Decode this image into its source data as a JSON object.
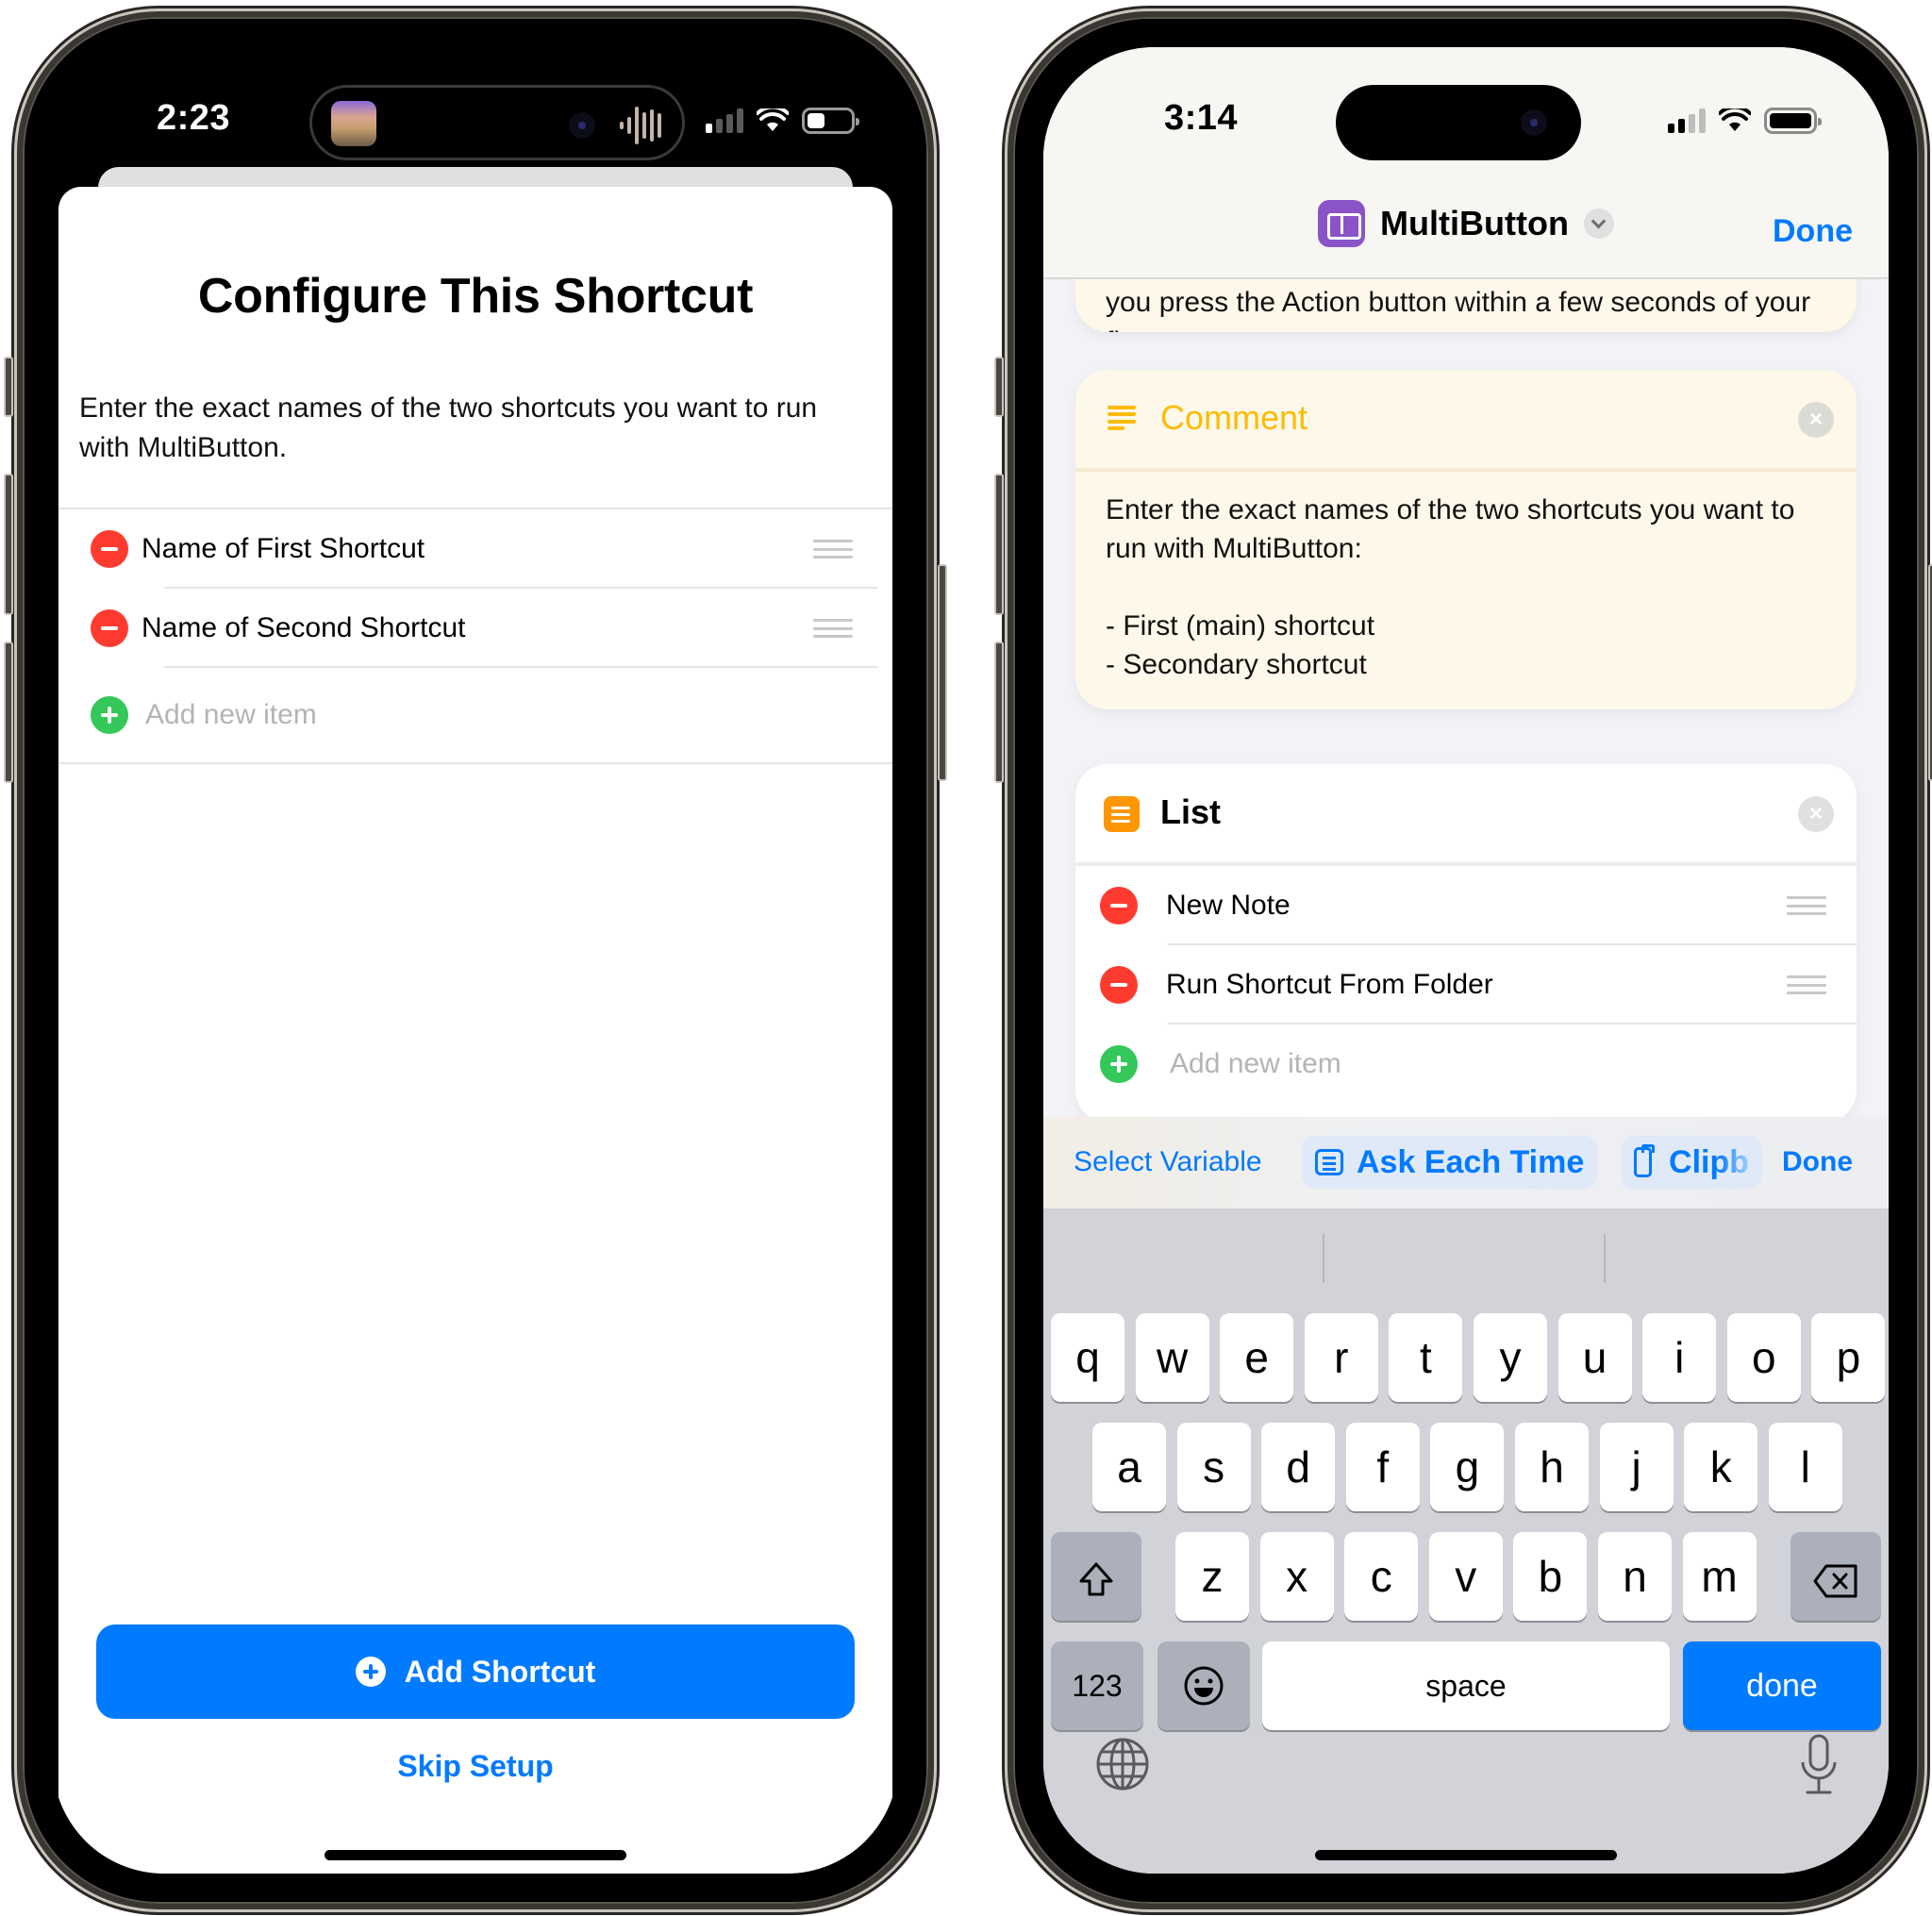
{
  "left_phone": {
    "status_bar": {
      "time": "2:23",
      "now_playing_icon": "album-art",
      "waveform_icon": "waveform",
      "signal_bars_active": 1,
      "battery_level": 0.4
    },
    "sheet": {
      "title": "Configure This Shortcut",
      "description": "Enter the exact names of the two shortcuts you want to run with MultiButton.",
      "items": [
        {
          "label": "Name of First Shortcut"
        },
        {
          "label": "Name of Second Shortcut"
        }
      ],
      "add_item_placeholder": "Add new item",
      "primary_button": "Add Shortcut",
      "secondary_link": "Skip Setup"
    }
  },
  "right_phone": {
    "status_bar": {
      "time": "3:14",
      "signal_bars_active": 2,
      "battery_level": 1.0
    },
    "nav_bar": {
      "title": "MultiButton",
      "done_label": "Done"
    },
    "clipped_card_text": "you press the Action button within a few seconds of your first",
    "comment_card": {
      "title": "Comment",
      "body": "Enter the exact names of the two shortcuts you want to run with MultiButton:\n\n- First (main) shortcut\n- Secondary shortcut"
    },
    "list_card": {
      "title": "List",
      "items": [
        {
          "label": "New Note"
        },
        {
          "label": "Run Shortcut From Folder"
        }
      ],
      "add_item_placeholder": "Add new item"
    },
    "accessory_bar": {
      "select_variable": "Select Variable",
      "ask_each_time": "Ask Each Time",
      "clipboard": "Clipb",
      "done": "Done"
    },
    "keyboard": {
      "row1": [
        "q",
        "w",
        "e",
        "r",
        "t",
        "y",
        "u",
        "i",
        "o",
        "p"
      ],
      "row2": [
        "a",
        "s",
        "d",
        "f",
        "g",
        "h",
        "j",
        "k",
        "l"
      ],
      "row3": [
        "z",
        "x",
        "c",
        "v",
        "b",
        "n",
        "m"
      ],
      "numbers_key": "123",
      "space_key": "space",
      "return_key": "done"
    }
  },
  "colors": {
    "accent_blue": "#007aff",
    "remove_red": "#ff3b30",
    "add_green": "#34c759",
    "comment_yellow": "#fbbc04",
    "comment_bg": "#fef8ea",
    "list_orange": "#ff9500",
    "app_purple": "#8a54c8"
  }
}
